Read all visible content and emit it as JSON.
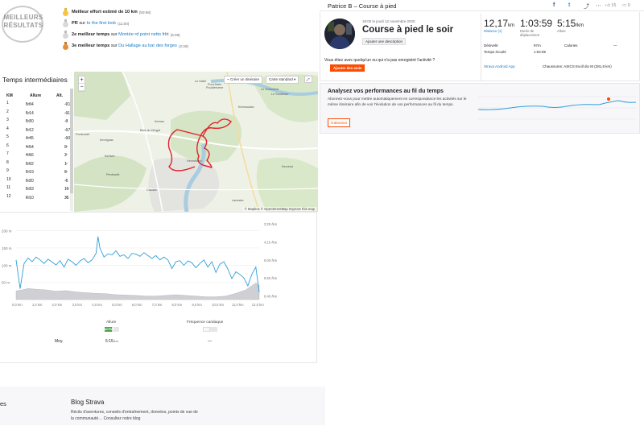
{
  "best_results": {
    "badge_line1": "MEILLEURS",
    "badge_line2": "RÉSULTATS",
    "items": [
      {
        "medal": "gold",
        "strong": "Meilleur effort estimé de 10 km",
        "middle": "",
        "link": "",
        "time": "(50:58)"
      },
      {
        "medal": "silver",
        "strong": "PR",
        "middle": "sur",
        "link": "to the first look",
        "time": "(11:00)"
      },
      {
        "medal": "silver",
        "strong": "2e meilleur temps",
        "middle": "sur",
        "link": "Montée rd point netto frbt",
        "time": "(6:38)"
      },
      {
        "medal": "bronze",
        "strong": "3e meilleur temps",
        "middle": "sur",
        "link": "Du Hallage au bar des forges",
        "time": "(2:49)"
      }
    ]
  },
  "splits": {
    "title": "Temps intermédiaires",
    "headers": [
      "KM",
      "Allure",
      "Alt."
    ],
    "unit_pace": "/km",
    "unit_elev": "m",
    "rows": [
      {
        "km": "1",
        "pace": "5:04",
        "elev": "-21"
      },
      {
        "km": "2",
        "pace": "5:14",
        "elev": "-11"
      },
      {
        "km": "3",
        "pace": "5:20",
        "elev": "-3"
      },
      {
        "km": "4",
        "pace": "5:12",
        "elev": "-17"
      },
      {
        "km": "5",
        "pace": "4:45",
        "elev": "-10"
      },
      {
        "km": "6",
        "pace": "4:54",
        "elev": "0"
      },
      {
        "km": "7",
        "pace": "4:56",
        "elev": "2"
      },
      {
        "km": "8",
        "pace": "5:02",
        "elev": "1"
      },
      {
        "km": "9",
        "pace": "5:19",
        "elev": "6"
      },
      {
        "km": "10",
        "pace": "5:20",
        "elev": "-5"
      },
      {
        "km": "11",
        "pace": "5:33",
        "elev": "19"
      },
      {
        "km": "12",
        "pace": "6:10",
        "elev": "35"
      }
    ]
  },
  "map": {
    "btn_itinerary": "Créer un itinéraire",
    "btn_style": "Carte standard",
    "zoom_in": "+",
    "zoom_out": "−",
    "fullscreen": "⤢",
    "attribution": "© Mapbox © OpenStreetMap Improve this map",
    "places": [
      "Le Hallé",
      "Bois du Hérgot",
      "Pontcouet",
      "Hennebont",
      "Kerlivio",
      "Poul-Maïn",
      "Caudan",
      "Le Guémené",
      "Lanester",
      "Kervignac",
      "Penfrouët",
      "Le Soulleran",
      "Pouldervene",
      "Kerneu",
      "Kermoudan",
      "Kerzinot"
    ]
  },
  "chart": {
    "y_left_ticks": [
      "200 m",
      "150 m",
      "100 m",
      "50 m"
    ],
    "y_right_ticks": [
      "3:20 /km",
      "4:10 /km",
      "5:00 /km",
      "5:50 /km",
      "6:40 /km"
    ],
    "x_ticks": [
      "0,0 km",
      "1,0 km",
      "2,0 km",
      "3,0 km",
      "4,0 km",
      "5,0 km",
      "6,0 km",
      "7,0 km",
      "8,0 km",
      "9,0 km",
      "10,0 km",
      "11,0 km",
      "12,0 km"
    ]
  },
  "chart_data": {
    "type": "area",
    "x_range": [
      0,
      12.17
    ],
    "series": [
      {
        "role": "elevation",
        "axis": "left",
        "ylim": [
          0,
          220
        ],
        "x": [
          0,
          0.3,
          0.6,
          1,
          1.5,
          2,
          2.5,
          3,
          3.5,
          4,
          4.5,
          5,
          5.5,
          6,
          6.5,
          7,
          7.5,
          8,
          8.5,
          9,
          9.5,
          10,
          10.5,
          11,
          11.5,
          12,
          12.17
        ],
        "values": [
          25,
          28,
          32,
          30,
          28,
          24,
          26,
          22,
          20,
          18,
          17,
          14,
          13,
          12,
          10,
          10,
          12,
          14,
          12,
          10,
          8,
          8,
          10,
          18,
          28,
          48,
          42
        ]
      },
      {
        "role": "pace",
        "axis": "right",
        "unit": "s/km",
        "ylim": [
          200,
          410
        ],
        "x": [
          0,
          0.2,
          0.4,
          0.6,
          0.8,
          1,
          1.2,
          1.4,
          1.6,
          1.8,
          2,
          2.2,
          2.4,
          2.6,
          2.8,
          3,
          3.2,
          3.4,
          3.6,
          3.8,
          4,
          4.1,
          4.2,
          4.4,
          4.6,
          4.8,
          5,
          5.2,
          5.4,
          5.6,
          5.8,
          6,
          6.2,
          6.4,
          6.6,
          6.8,
          7,
          7.2,
          7.4,
          7.6,
          7.8,
          8,
          8.2,
          8.4,
          8.6,
          8.8,
          9,
          9.2,
          9.4,
          9.6,
          9.8,
          10,
          10.2,
          10.4,
          10.6,
          10.8,
          11,
          11.2,
          11.4,
          11.6,
          11.8,
          12,
          12.17
        ],
        "values": [
          300,
          380,
          310,
          295,
          305,
          292,
          300,
          310,
          298,
          306,
          314,
          302,
          320,
          298,
          305,
          315,
          303,
          296,
          308,
          300,
          282,
          235,
          268,
          292,
          283,
          286,
          275,
          290,
          286,
          296,
          282,
          284,
          290,
          280,
          288,
          296,
          288,
          300,
          292,
          300,
          324,
          305,
          302,
          315,
          303,
          308,
          322,
          310,
          300,
          320,
          305,
          335,
          312,
          305,
          325,
          352,
          333,
          340,
          350,
          372,
          340,
          320,
          390
        ]
      }
    ]
  },
  "toggles": {
    "pace_label": "Allure",
    "pace_state": "ACTIVÉ",
    "hr_label": "Fréquence cardiaque",
    "avg_label": "Moy.",
    "avg_pace": "5:15",
    "avg_pace_unit": "/km",
    "avg_hr": "—"
  },
  "footer": {
    "col1": "es",
    "blog_title": "Blog Strava",
    "blog_text": "Récits d'aventures, conseils d'entraînement, données, points de vue de la communauté… Consultez notre blog"
  },
  "activity": {
    "header_title": "Patrice B – Course à pied",
    "share_fb": "f",
    "share_tw": "t",
    "share_link": "⤴",
    "share_more": "⋯",
    "kudos_count": "15",
    "comments_count": "0",
    "date": "18:00 le jeudi 12 novembre 2020",
    "name": "Course à pied le soir",
    "btn_desc": "Ajouter une description",
    "kudos_question": "Vous étiez avec quelqu'un ou qui n'a pas enregistré l'activité ?",
    "btn_kudos": "Ajouter des amis",
    "distance": "12,17",
    "distance_unit": "km",
    "distance_label": "Distance (1)",
    "moving_time": "1:03:59",
    "moving_label": "Durée de déplacement",
    "pace": "5:15",
    "pace_unit": "/km",
    "pace_label": "Allure",
    "elev_label": "Dénivelé",
    "elev_value": "97m",
    "cal_label": "Calories",
    "cal_value": "—",
    "elapsed_label": "Temps écoulé",
    "elapsed_value": "1:04:05",
    "app": "Strava Android App",
    "shoes": "Chaussures: ASICS Evoll dio M (281,8 km)"
  },
  "analyze": {
    "title": "Analysez vos performances au fil du temps",
    "text": "Abonnez-vous pour mettre automatiquement en correspondance les activités sur le même itinéraire afin de voir l'évolution de vos performances au fil du temps.",
    "btn": "S'abonner"
  },
  "colors": {
    "brand": "#fc4c02",
    "route": "#e2212b",
    "pace_line": "#2f9fd8",
    "elevation_fill": "#cfcfd4",
    "link": "#1779c4"
  }
}
